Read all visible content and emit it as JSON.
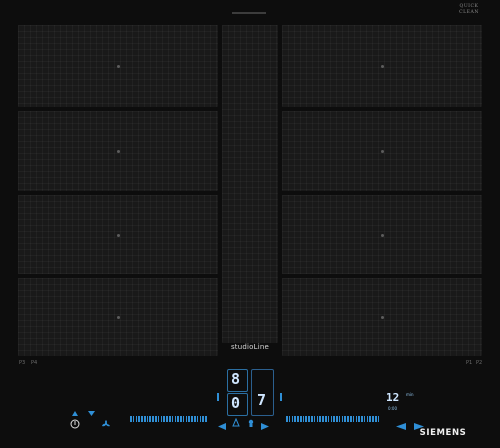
{
  "appliance": {
    "brand": "SIEMENS",
    "model_line": "studioLine",
    "feature_badge": [
      "QUICK",
      "CLEAN"
    ]
  },
  "cooking_zones": {
    "left": [
      "zone-1",
      "zone-2",
      "zone-3",
      "zone-4"
    ],
    "center": [
      "center-zone"
    ],
    "right": [
      "zone-5",
      "zone-6",
      "zone-7",
      "zone-8"
    ]
  },
  "markings": {
    "left_corner": "P3",
    "left_corner_b": "P4",
    "right_corner": "P1",
    "right_corner_b": "P2"
  },
  "controls": {
    "power_level_display": "8",
    "secondary_display": "0",
    "selected_level": "7",
    "timer_value": "12",
    "timer_unit": "min",
    "timer_sub": "0:00"
  },
  "colors": {
    "panel": "#0d0d0d",
    "zone_surface": "#191919",
    "control_blue": "#2f8fd6",
    "display_text": "#cfe6ff"
  },
  "icons": {
    "power": "power-icon",
    "fan": "fan-icon",
    "heat": "heat-icon",
    "favorite": "favorite-icon",
    "minus": "minus-icon",
    "plus": "plus-icon"
  }
}
